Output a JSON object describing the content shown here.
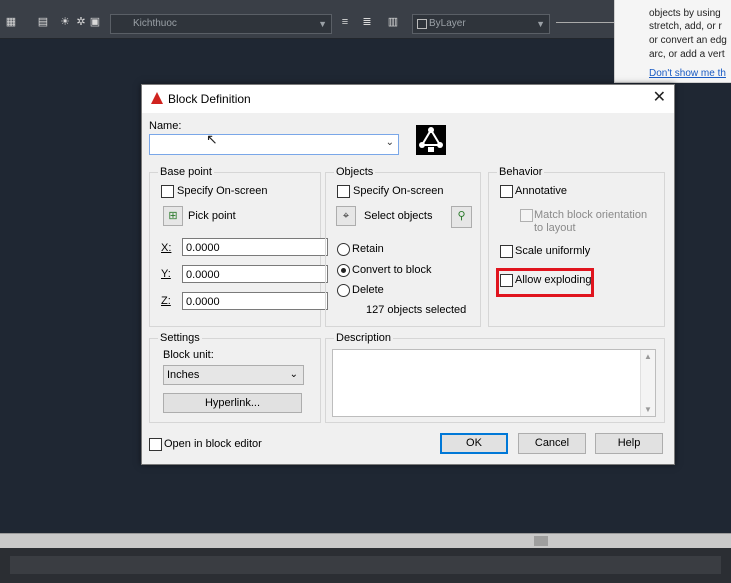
{
  "toolbar": {
    "layer_name": "Kichthuoc",
    "color_value": "ByLayer"
  },
  "tooltip": {
    "lines": [
      "objects by using",
      "stretch, add, or r",
      "or convert an edg",
      "arc, or add a vert"
    ],
    "link": "Don't show me th"
  },
  "dialog": {
    "title": "Block Definition",
    "name_label": "Name:",
    "name_value": "",
    "base_point": {
      "group_title": "Base point",
      "specify_on_screen": "Specify On-screen",
      "pick_point": "Pick point",
      "x_label": "X:",
      "x_value": "0.0000",
      "y_label": "Y:",
      "y_value": "0.0000",
      "z_label": "Z:",
      "z_value": "0.0000"
    },
    "objects": {
      "group_title": "Objects",
      "specify_on_screen": "Specify On-screen",
      "select_objects": "Select objects",
      "retain": "Retain",
      "convert_to_block": "Convert to block",
      "delete": "Delete",
      "selected_count": "127 objects selected",
      "selected_option": "convert_to_block"
    },
    "behavior": {
      "group_title": "Behavior",
      "annotative": "Annotative",
      "match_orientation_line1": "Match block orientation",
      "match_orientation_line2": "to layout",
      "scale_uniformly": "Scale uniformly",
      "allow_exploding": "Allow exploding"
    },
    "settings": {
      "group_title": "Settings",
      "block_unit_label": "Block unit:",
      "block_unit_value": "Inches",
      "hyperlink_button": "Hyperlink..."
    },
    "description": {
      "group_title": "Description",
      "value": ""
    },
    "open_in_block_editor": "Open in block editor",
    "buttons": {
      "ok": "OK",
      "cancel": "Cancel",
      "help": "Help"
    },
    "highlight_color": "#e0141e"
  }
}
